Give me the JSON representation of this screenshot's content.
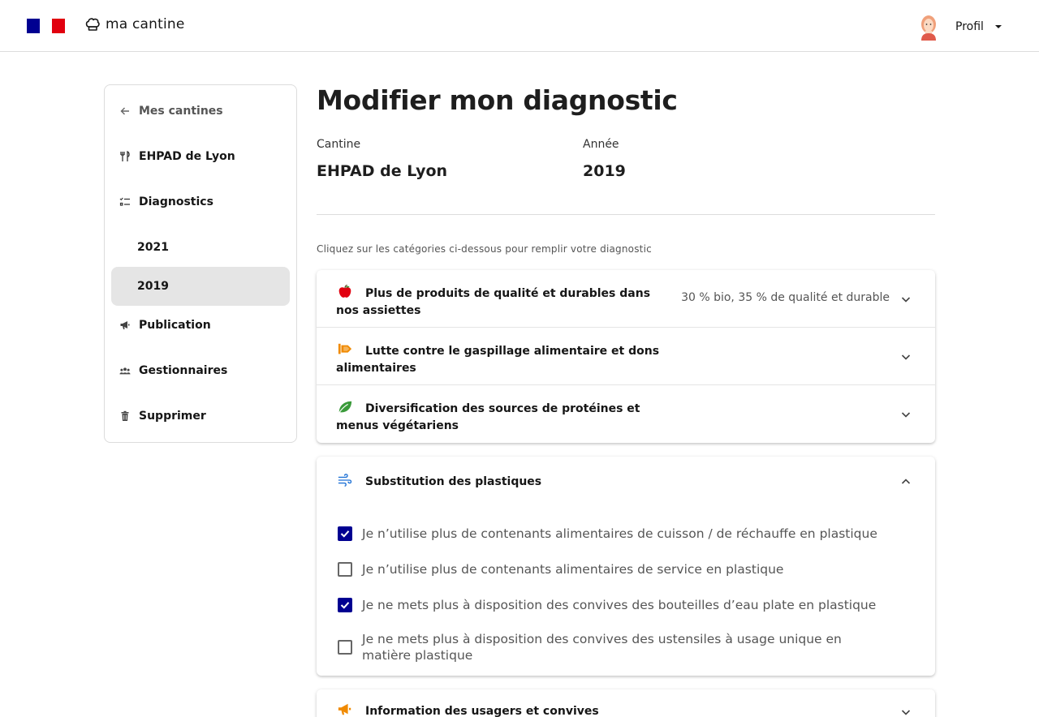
{
  "header": {
    "brand": "ma cantine",
    "profile_label": "Profil"
  },
  "sidebar": {
    "back": "Mes cantines",
    "canteen": "EHPAD de Lyon",
    "diagnostics": "Diagnostics",
    "years": [
      "2021",
      "2019"
    ],
    "active_year": "2019",
    "publication": "Publication",
    "managers": "Gestionnaires",
    "delete": "Supprimer"
  },
  "main": {
    "title": "Modifier mon diagnostic",
    "canteen_label": "Cantine",
    "canteen_value": "EHPAD de Lyon",
    "year_label": "Année",
    "year_value": "2019",
    "hint": "Cliquez sur les catégories ci-dessous pour remplir votre diagnostic"
  },
  "categories": [
    {
      "title": "Plus de produits de qualité et durables dans nos assiettes",
      "summary": "30 % bio, 35 % de qualité et durable",
      "icon": "apple-icon"
    },
    {
      "title": "Lutte contre le gaspillage alimentaire et dons alimentaires",
      "summary": "",
      "icon": "waste-icon"
    },
    {
      "title": "Diversification des sources de protéines et menus végétariens",
      "summary": "",
      "icon": "leaf-icon"
    }
  ],
  "plastics": {
    "title": "Substitution des plastiques",
    "icon": "wind-icon",
    "items": [
      {
        "label": "Je n’utilise plus de contenants alimentaires de cuisson / de réchauffe en plastique",
        "checked": true
      },
      {
        "label": "Je n’utilise plus de contenants alimentaires de service en plastique",
        "checked": false
      },
      {
        "label": "Je ne mets plus à disposition des convives des bouteilles d’eau plate en plastique",
        "checked": true
      },
      {
        "label": "Je ne mets plus à disposition des convives des ustensiles à usage unique en matière plastique",
        "checked": false
      }
    ]
  },
  "information": {
    "title": "Information des usagers et convives",
    "icon": "megaphone-icon"
  },
  "colors": {
    "accent": "#000091",
    "flag_red": "#e1000f"
  }
}
